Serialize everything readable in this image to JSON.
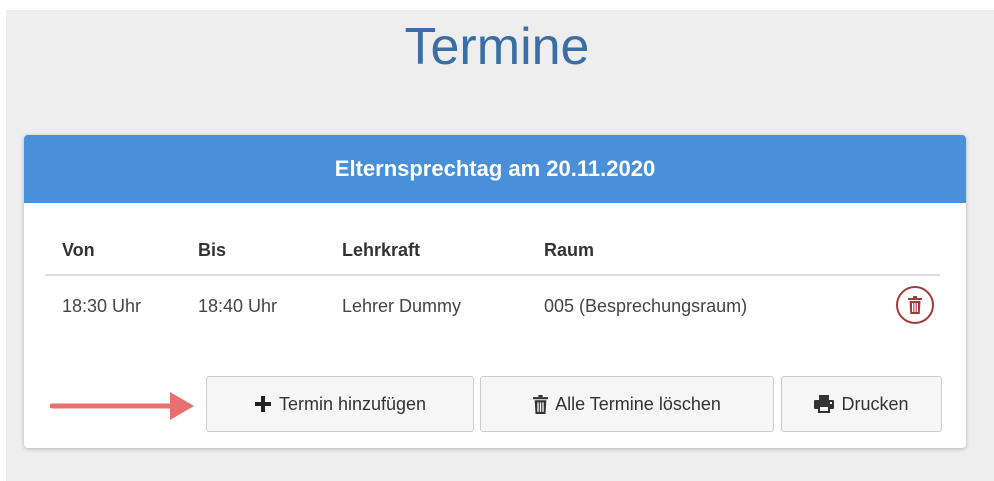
{
  "page": {
    "title": "Termine"
  },
  "panel": {
    "header": "Elternsprechtag am 20.11.2020"
  },
  "table": {
    "columns": [
      "Von",
      "Bis",
      "Lehrkraft",
      "Raum"
    ],
    "rows": [
      {
        "von": "18:30 Uhr",
        "bis": "18:40 Uhr",
        "lehrkraft": "Lehrer Dummy",
        "raum": "005 (Besprechungsraum)"
      }
    ]
  },
  "buttons": {
    "add": "Termin hinzufügen",
    "delete_all": "Alle Termine löschen",
    "print": "Drucken"
  },
  "icons": {
    "row_delete": "trash-icon",
    "add": "plus-icon",
    "delete_all": "trash-icon",
    "print": "printer-icon",
    "pointer": "arrow-right-icon"
  },
  "colors": {
    "title": "#3a6ea5",
    "header_bg": "#4a90d9",
    "delete": "#a33a3a",
    "arrow": "#e87070"
  }
}
